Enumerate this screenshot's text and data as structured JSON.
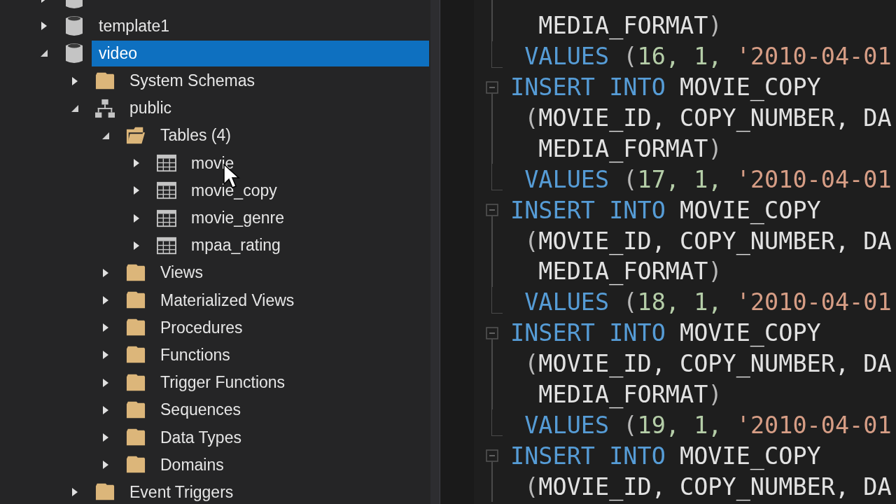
{
  "tree": [
    {
      "kind": "database",
      "expanded": false
    },
    {
      "label": "template1",
      "kind": "database",
      "expanded": false,
      "selected": false
    },
    {
      "label": "video",
      "kind": "database",
      "expanded": true,
      "selected": true,
      "children": [
        {
          "label": "System Schemas",
          "kind": "folder",
          "expanded": false,
          "selected": false
        },
        {
          "label": "public",
          "kind": "schema",
          "expanded": true,
          "selected": false,
          "children": [
            {
              "label": "Tables (4)",
              "kind": "open_folder",
              "expanded": true,
              "selected": false,
              "children": [
                {
                  "label": "movie",
                  "kind": "table",
                  "expanded": false,
                  "selected": false
                },
                {
                  "label": "movie_copy",
                  "kind": "table",
                  "expanded": false,
                  "selected": false
                },
                {
                  "label": "movie_genre",
                  "kind": "table",
                  "expanded": false,
                  "selected": false
                },
                {
                  "label": "mpaa_rating",
                  "kind": "table",
                  "expanded": false,
                  "selected": false
                }
              ]
            },
            {
              "label": "Views",
              "kind": "folder",
              "expanded": false,
              "selected": false
            },
            {
              "label": "Materialized Views",
              "kind": "folder",
              "expanded": false,
              "selected": false
            },
            {
              "label": "Procedures",
              "kind": "folder",
              "expanded": false,
              "selected": false
            },
            {
              "label": "Functions",
              "kind": "folder",
              "expanded": false,
              "selected": false
            },
            {
              "label": "Trigger Functions",
              "kind": "folder",
              "expanded": false,
              "selected": false
            },
            {
              "label": "Sequences",
              "kind": "folder",
              "expanded": false,
              "selected": false
            },
            {
              "label": "Data Types",
              "kind": "folder",
              "expanded": false,
              "selected": false
            },
            {
              "label": "Domains",
              "kind": "folder",
              "expanded": false,
              "selected": false
            }
          ]
        },
        {
          "label": "Event Triggers",
          "kind": "folder",
          "expanded": false,
          "selected": false
        }
      ]
    }
  ],
  "editor": {
    "lines": [
      {
        "kind": "fold_body"
      },
      {
        "kind": "fold_body",
        "tokens": [
          {
            "kind": "ident",
            "text": "  MEDIA_FORMAT"
          },
          {
            "kind": "punct",
            "text": ")"
          }
        ]
      },
      {
        "kind": "fold_end",
        "tokens": [
          {
            "kind": "keyword",
            "text": " VALUES "
          },
          {
            "kind": "punct",
            "text": "("
          },
          {
            "kind": "number",
            "text": "16, 1, "
          },
          {
            "kind": "string",
            "text": "'2010-04-01"
          }
        ]
      },
      {
        "kind": "fold_start",
        "tokens": [
          {
            "kind": "keyword",
            "text": "INSERT INTO "
          },
          {
            "kind": "ident",
            "text": "MOVIE_COPY"
          }
        ]
      },
      {
        "kind": "fold_body",
        "tokens": [
          {
            "kind": "punct",
            "text": " ("
          },
          {
            "kind": "ident",
            "text": "MOVIE_ID, COPY_NUMBER, DA"
          }
        ]
      },
      {
        "kind": "fold_body",
        "tokens": [
          {
            "kind": "ident",
            "text": "  MEDIA_FORMAT"
          },
          {
            "kind": "punct",
            "text": ")"
          }
        ]
      },
      {
        "kind": "fold_end",
        "tokens": [
          {
            "kind": "keyword",
            "text": " VALUES "
          },
          {
            "kind": "punct",
            "text": "("
          },
          {
            "kind": "number",
            "text": "17, 1, "
          },
          {
            "kind": "string",
            "text": "'2010-04-01"
          }
        ]
      },
      {
        "kind": "fold_start",
        "tokens": [
          {
            "kind": "keyword",
            "text": "INSERT INTO "
          },
          {
            "kind": "ident",
            "text": "MOVIE_COPY"
          }
        ]
      },
      {
        "kind": "fold_body",
        "tokens": [
          {
            "kind": "punct",
            "text": " ("
          },
          {
            "kind": "ident",
            "text": "MOVIE_ID, COPY_NUMBER, DA"
          }
        ]
      },
      {
        "kind": "fold_body",
        "tokens": [
          {
            "kind": "ident",
            "text": "  MEDIA_FORMAT"
          },
          {
            "kind": "punct",
            "text": ")"
          }
        ]
      },
      {
        "kind": "fold_end",
        "tokens": [
          {
            "kind": "keyword",
            "text": " VALUES "
          },
          {
            "kind": "punct",
            "text": "("
          },
          {
            "kind": "number",
            "text": "18, 1, "
          },
          {
            "kind": "string",
            "text": "'2010-04-01"
          }
        ]
      },
      {
        "kind": "fold_start",
        "tokens": [
          {
            "kind": "keyword",
            "text": "INSERT INTO "
          },
          {
            "kind": "ident",
            "text": "MOVIE_COPY"
          }
        ]
      },
      {
        "kind": "fold_body",
        "tokens": [
          {
            "kind": "punct",
            "text": " ("
          },
          {
            "kind": "ident",
            "text": "MOVIE_ID, COPY_NUMBER, DA"
          }
        ]
      },
      {
        "kind": "fold_body",
        "tokens": [
          {
            "kind": "ident",
            "text": "  MEDIA_FORMAT"
          },
          {
            "kind": "punct",
            "text": ")"
          }
        ]
      },
      {
        "kind": "fold_end",
        "tokens": [
          {
            "kind": "keyword",
            "text": " VALUES "
          },
          {
            "kind": "punct",
            "text": "("
          },
          {
            "kind": "number",
            "text": "19, 1, "
          },
          {
            "kind": "string",
            "text": "'2010-04-01"
          }
        ]
      },
      {
        "kind": "fold_start",
        "tokens": [
          {
            "kind": "keyword",
            "text": "INSERT INTO "
          },
          {
            "kind": "ident",
            "text": "MOVIE_COPY"
          }
        ]
      },
      {
        "kind": "fold_body",
        "tokens": [
          {
            "kind": "punct",
            "text": " ("
          },
          {
            "kind": "ident",
            "text": "MOVIE_ID, COPY_NUMBER, DA"
          }
        ]
      }
    ]
  }
}
